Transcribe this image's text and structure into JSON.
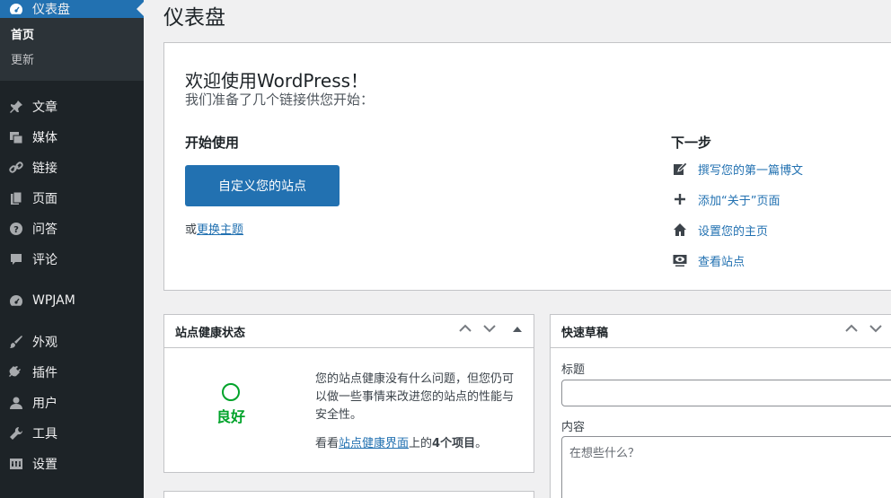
{
  "sidebar": {
    "dashboard": "仪表盘",
    "sub": [
      "首页",
      "更新"
    ],
    "items": [
      {
        "label": "文章",
        "icon": "pin-icon"
      },
      {
        "label": "媒体",
        "icon": "media-icon"
      },
      {
        "label": "链接",
        "icon": "link-icon"
      },
      {
        "label": "页面",
        "icon": "page-icon"
      },
      {
        "label": "问答",
        "icon": "help-icon"
      },
      {
        "label": "评论",
        "icon": "comment-icon"
      },
      {
        "label": "WPJAM",
        "icon": "gauge-icon"
      },
      {
        "label": "外观",
        "icon": "brush-icon"
      },
      {
        "label": "插件",
        "icon": "plugin-icon"
      },
      {
        "label": "用户",
        "icon": "user-icon"
      },
      {
        "label": "工具",
        "icon": "wrench-icon"
      },
      {
        "label": "设置",
        "icon": "settings-icon"
      }
    ]
  },
  "page_title": "仪表盘",
  "welcome": {
    "title": "欢迎使用WordPress！",
    "about": "我们准备了几个链接供您开始：",
    "start_title": "开始使用",
    "customize_button": "自定义您的站点",
    "theme_prefix": "或",
    "theme_link": "更换主题",
    "next_title": "下一步",
    "next_items": [
      {
        "label": "撰写您的第一篇博文",
        "icon": "edit-icon"
      },
      {
        "label": "添加“关于”页面",
        "icon": "plus-icon"
      },
      {
        "label": "设置您的主页",
        "icon": "home-icon"
      },
      {
        "label": "查看站点",
        "icon": "view-icon"
      }
    ]
  },
  "site_health": {
    "title": "站点健康状态",
    "status": "良好",
    "description": "您的站点健康没有什么问题，但您仍可以做一些事情来改进您的站点的性能与安全性。",
    "items_prefix": "看看",
    "items_link": "站点健康界面",
    "items_middle": "上的",
    "items_count": "4个项目",
    "items_suffix": "。"
  },
  "quick_draft": {
    "title": "快速草稿",
    "title_label": "标题",
    "content_label": "内容",
    "content_placeholder": "在想些什么？"
  }
}
